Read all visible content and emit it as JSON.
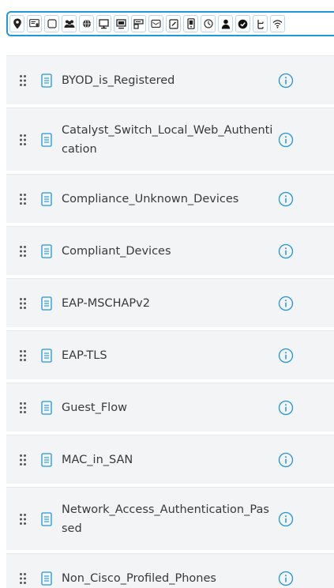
{
  "toolbar": {
    "icons": [
      "location-pin-icon",
      "id-card-icon",
      "square-icon",
      "group-icon",
      "globe-icon",
      "desktop-icon",
      "monitor-icon",
      "network-device-icon",
      "mail-icon",
      "file-edit-icon",
      "mobile-device-icon",
      "clock-icon",
      "user-icon",
      "check-circle-icon",
      "hierarchy-icon",
      "wifi-icon"
    ],
    "accent_color": "#1f97d9"
  },
  "conditions": [
    {
      "name": "BYOD_is_Registered"
    },
    {
      "name": "Catalyst_Switch_Local_Web_Authentication"
    },
    {
      "name": "Compliance_Unknown_Devices"
    },
    {
      "name": "Compliant_Devices"
    },
    {
      "name": "EAP-MSCHAPv2"
    },
    {
      "name": "EAP-TLS"
    },
    {
      "name": "Guest_Flow"
    },
    {
      "name": "MAC_in_SAN"
    },
    {
      "name": "Network_Access_Authentication_Passed"
    },
    {
      "name": "Non_Cisco_Profiled_Phones"
    }
  ]
}
